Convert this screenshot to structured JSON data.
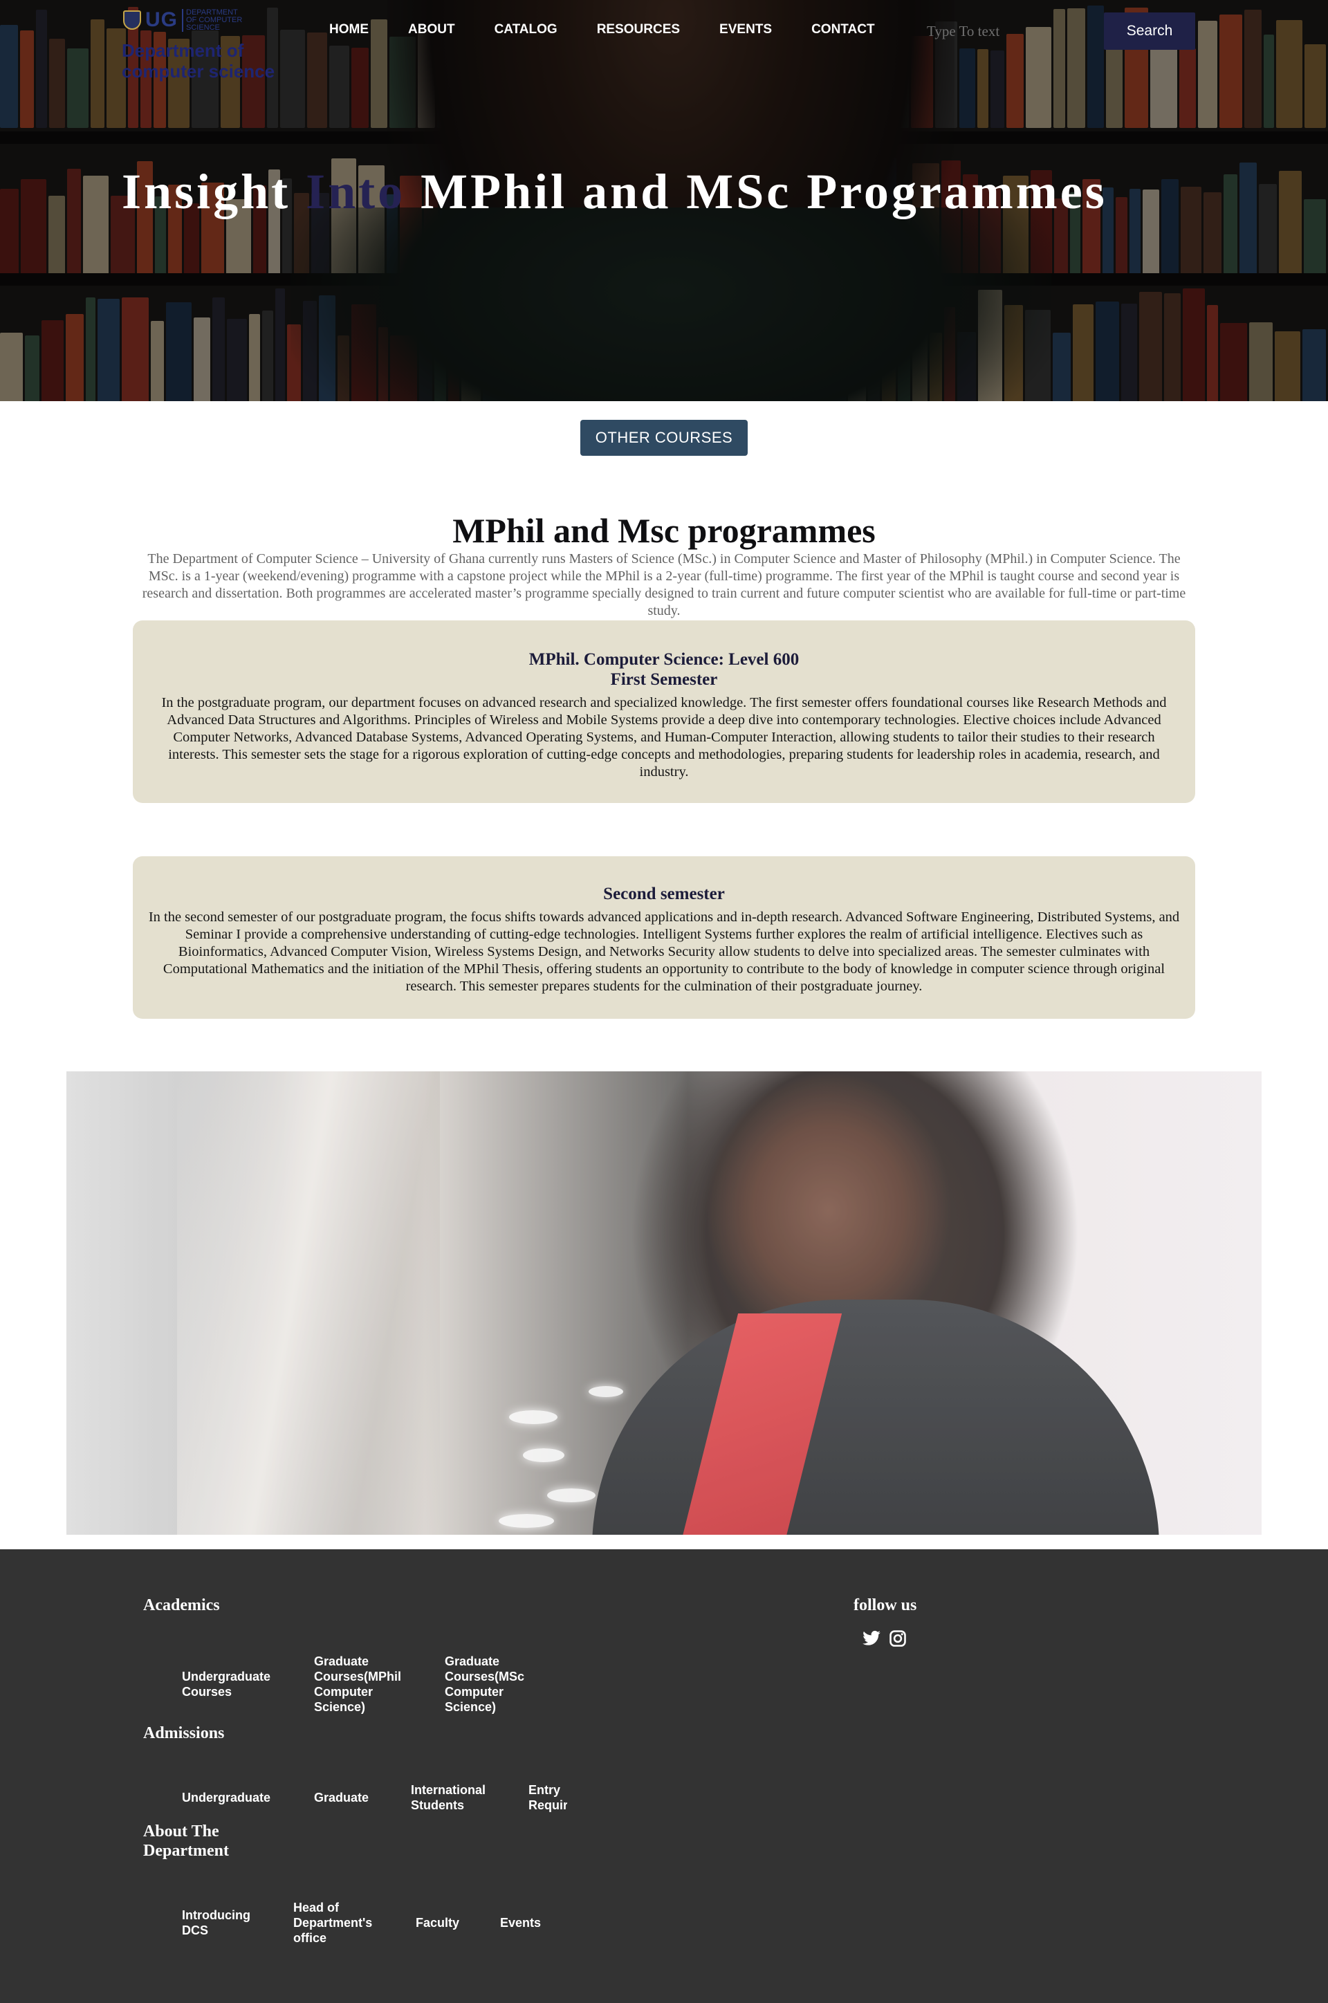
{
  "header": {
    "logo_text": "UG",
    "logo_subtext": "DEPARTMENT OF COMPUTER SCIENCE",
    "department_name": "Department of computer science",
    "nav": [
      "HOME",
      "ABOUT",
      "CATALOG",
      "RESOURCES",
      "EVENTS",
      "CONTACT"
    ],
    "search_placeholder": "Type To text",
    "search_button": "Search"
  },
  "hero": {
    "title_part1": "Insight ",
    "title_accent": "Into",
    "title_part2": " MPhil and MSc Programmes",
    "accent_color": "#252253"
  },
  "other_courses_button": "OTHER COURSES",
  "main": {
    "title": "MPhil and Msc programmes",
    "intro": "The Department of Computer Science – University of Ghana currently runs Masters of Science (MSc.) in Computer Science and Master of Philosophy (MPhil.) in Computer Science. The MSc. is a 1-year (weekend/evening) programme with a capstone project while the MPhil is a 2-year (full-time) programme. The first year of the MPhil is taught course and second year is research and dissertation. Both programmes are accelerated master’s programme specially designed to train current and future computer scientist who are available for full-time or part-time study.",
    "card1": {
      "title_line1": "MPhil. Computer Science: Level 600",
      "title_line2": "First Semester",
      "text": "In the postgraduate program, our department focuses on advanced research and specialized knowledge. The first semester offers foundational courses like Research Methods and Advanced Data Structures and Algorithms. Principles of Wireless and Mobile Systems provide a deep dive into contemporary technologies. Elective choices include Advanced Computer Networks, Advanced Database Systems, Advanced Operating Systems, and Human-Computer Interaction, allowing students to tailor their studies to their research interests. This semester sets the stage for a rigorous exploration of cutting-edge concepts and methodologies, preparing students for leadership roles in academia, research, and industry."
    },
    "card2": {
      "title": "Second semester",
      "text": "In the second semester of our postgraduate program, the focus shifts towards advanced applications and in-depth research. Advanced Software Engineering, Distributed Systems, and Seminar I provide a comprehensive understanding of cutting-edge technologies. Intelligent Systems further explores the realm of artificial intelligence. Electives such as Bioinformatics, Advanced Computer Vision, Wireless Systems Design, and Networks Security allow students to delve into specialized areas. The semester culminates with Computational Mathematics and the initiation of the MPhil Thesis, offering students an opportunity to contribute to the body of knowledge in computer science through original research. This semester prepares students for the culmination of their postgraduate journey."
    },
    "card_bg": "#e4e0cf"
  },
  "footer": {
    "academics": {
      "heading": "Academics",
      "links": [
        "Undergraduate Courses",
        "Graduate Courses(MPhil Computer Science)",
        "Graduate Courses(MSc Computer Science)"
      ]
    },
    "admissions": {
      "heading": "Admissions",
      "links": [
        "Undergraduate",
        "Graduate",
        "International Students",
        "Entry Requirements"
      ]
    },
    "about": {
      "heading": "About The Department",
      "links": [
        "Introducing DCS",
        "Head of Department's office",
        "Faculty",
        "Events"
      ]
    },
    "follow": {
      "heading": "follow us",
      "icons": [
        "twitter-icon",
        "instagram-icon"
      ]
    },
    "bg_color": "#333333"
  }
}
